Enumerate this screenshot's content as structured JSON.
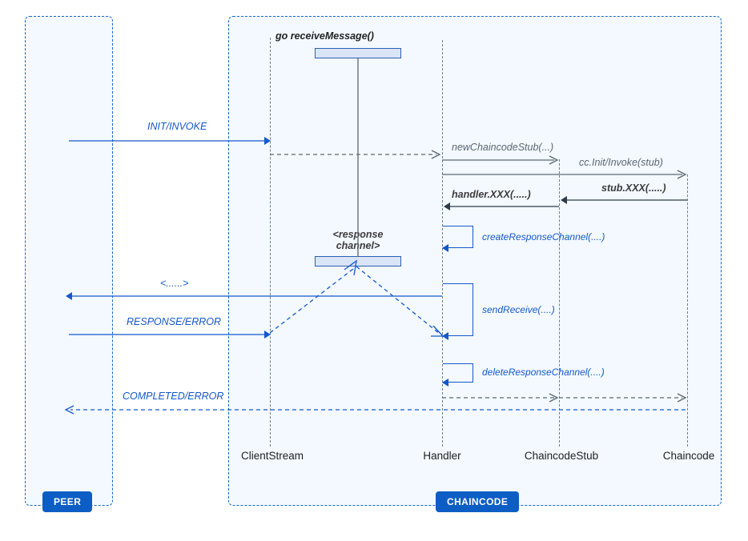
{
  "peer_label": "PEER",
  "chaincode_label": "CHAINCODE",
  "lifelines": {
    "clientstream": "ClientStream",
    "handler": "Handler",
    "stub": "ChaincodeStub",
    "cc": "Chaincode"
  },
  "messages": {
    "goreceive": "go receiveMessage()",
    "init": "INIT/INVOKE",
    "newstub": "newChaincodeStub(...)",
    "ccinit": "cc.Init/Invoke(stub)",
    "stubxxx": "stub.XXX(.....)",
    "handlerxxx": "handler.XXX(.....)",
    "respch": "<response channel>",
    "createresp": "createResponseChannel(....)",
    "dots": "<......>",
    "sendrecv": "sendReceive(....)",
    "resperr": "RESPONSE/ERROR",
    "delresp": "deleteResponseChannel(....)",
    "completed": "COMPLETED/ERROR"
  }
}
